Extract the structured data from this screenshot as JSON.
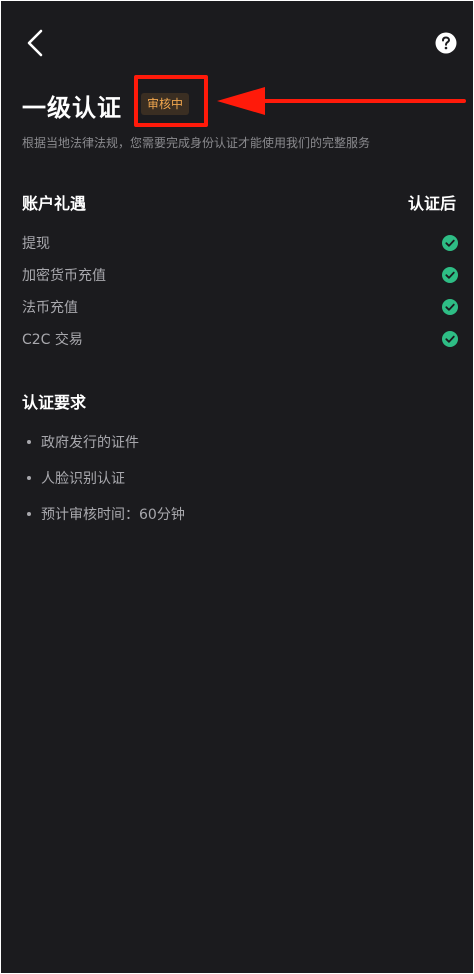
{
  "header": {
    "back_icon": "chevron-left-icon",
    "help_icon": "question-circle-icon"
  },
  "title": "一级认证",
  "status_badge": "审核中",
  "subtitle": "根据当地法律法规，您需要完成身份认证才能使用我们的完整服务",
  "benefits": {
    "heading": "账户礼遇",
    "column_label": "认证后",
    "items": [
      {
        "label": "提现",
        "icon": "check-circle-icon"
      },
      {
        "label": "加密货币充值",
        "icon": "check-circle-icon"
      },
      {
        "label": "法币充值",
        "icon": "check-circle-icon"
      },
      {
        "label": "C2C 交易",
        "icon": "check-circle-icon"
      }
    ]
  },
  "requirements": {
    "heading": "认证要求",
    "items": [
      {
        "text": "政府发行的证件"
      },
      {
        "text": "人脸识别认证"
      },
      {
        "text": "预计审核时间：60分钟"
      }
    ]
  },
  "colors": {
    "background": "#1b1b1e",
    "badge_text": "#f0a64e",
    "check_green": "#2ebd85",
    "annotation_red": "#ff1a0a"
  }
}
